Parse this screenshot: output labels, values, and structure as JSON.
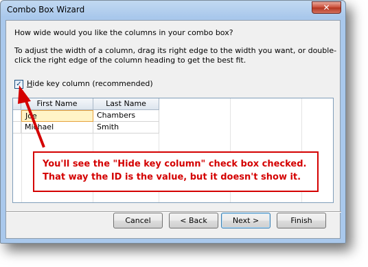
{
  "window": {
    "title": "Combo Box Wizard",
    "close_glyph": "✕"
  },
  "wizard": {
    "prompt": "How wide would you like the columns in your combo box?",
    "instructions": "To adjust the width of a column, drag its right edge to the width you want, or double-click the right edge of the column heading to get the best fit.",
    "hide_key_checkbox": {
      "label": "Hide key column (recommended)",
      "checked": true,
      "check_glyph": "✓"
    }
  },
  "grid": {
    "columns": [
      "First Name",
      "Last Name"
    ],
    "rows": [
      [
        "Joe",
        "Chambers"
      ],
      [
        "Michael",
        "Smith"
      ]
    ]
  },
  "buttons": {
    "cancel": "Cancel",
    "back": "< Back",
    "next": "Next >",
    "finish": "Finish"
  },
  "annotation": {
    "line1": "You'll see the \"Hide key column\" check box checked.",
    "line2": "That way the ID is the value, but it doesn't show it.",
    "color": "#d40000"
  }
}
